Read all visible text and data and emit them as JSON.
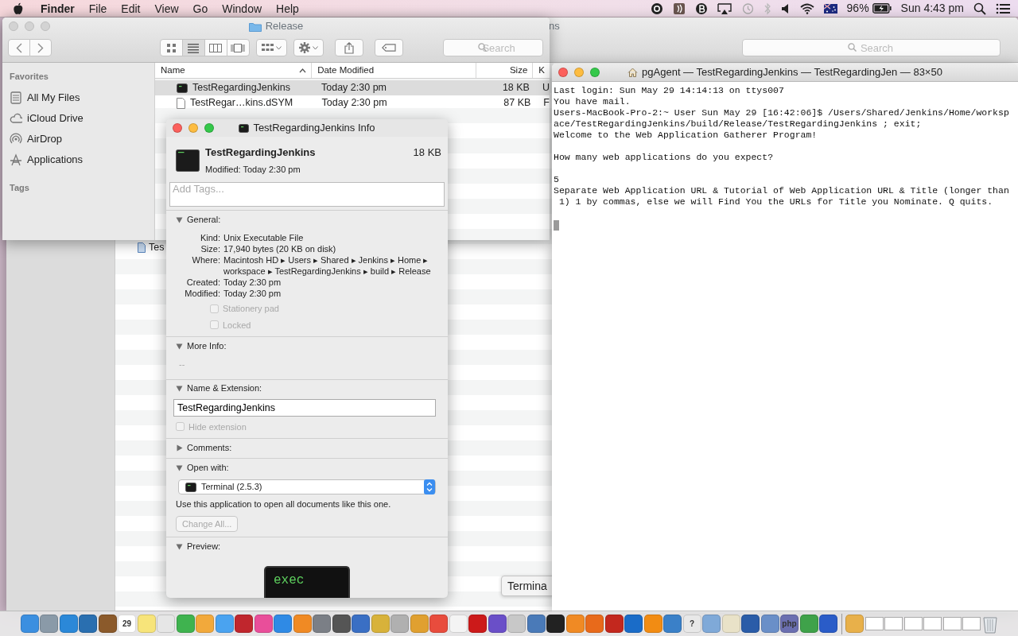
{
  "menu_bar": {
    "app": "Finder",
    "menus": [
      "File",
      "Edit",
      "View",
      "Go",
      "Window",
      "Help"
    ],
    "battery_percent": "96%",
    "clock": "Sun 4:43 pm"
  },
  "background_window": {
    "title": "ns",
    "search_placeholder": "Search",
    "file_name": "Tes"
  },
  "finder": {
    "active": false,
    "title": "Release",
    "search_placeholder": "Search",
    "view_modes": [
      {
        "kind": "icons",
        "selected": false
      },
      {
        "kind": "list",
        "selected": true
      },
      {
        "kind": "columns",
        "selected": false
      },
      {
        "kind": "coverflow",
        "selected": false
      }
    ],
    "sidebar": [
      {
        "heading": "Favorites",
        "items": [
          {
            "label": "All My Files",
            "kind": "files"
          },
          {
            "label": "iCloud Drive",
            "kind": "cloud"
          },
          {
            "label": "AirDrop",
            "kind": "airdrop"
          },
          {
            "label": "Applications",
            "kind": "apps"
          }
        ]
      },
      {
        "heading": "Tags"
      }
    ],
    "columns": [
      "Name",
      "Date Modified",
      "Size",
      "K"
    ],
    "rows": [
      {
        "kind": "executable",
        "name": "TestRegardingJenkins",
        "date": "Today 2:30 pm",
        "size": "18 KB",
        "column_4": "U",
        "selected": true
      },
      {
        "kind": "document",
        "name": "TestRegar…kins.dSYM",
        "date": "Today 2:30 pm",
        "size": "87 KB",
        "column_4": "F",
        "selected": false
      }
    ]
  },
  "info": {
    "active": true,
    "title": "TestRegardingJenkins Info",
    "name": "TestRegardingJenkins",
    "modified": "Modified: Today 2:30 pm",
    "size": "18 KB",
    "tags_placeholder": "Add Tags...",
    "sections": [
      {
        "kind": "general",
        "title": "General:",
        "expanded": true,
        "fields": [
          {
            "label": "Kind:",
            "value": "Unix Executable File"
          },
          {
            "label": "Size:",
            "value": "17,940 bytes (20 KB on disk)"
          },
          {
            "label": "Where:",
            "value": "Macintosh HD ▸ Users ▸ Shared ▸ Jenkins ▸ Home ▸ workspace ▸ TestRegardingJenkins ▸ build ▸ Release"
          },
          {
            "label": "Created:",
            "value": "Today 2:30 pm"
          },
          {
            "label": "Modified:",
            "value": "Today 2:30 pm"
          }
        ],
        "checkboxes": [
          {
            "label": "Stationery pad",
            "checked": false,
            "disabled": true
          },
          {
            "label": "Locked",
            "checked": false,
            "disabled": true
          }
        ]
      },
      {
        "kind": "more_info",
        "title": "More Info:",
        "expanded": true,
        "value": "--"
      },
      {
        "kind": "name_extension",
        "title": "Name & Extension:",
        "expanded": true,
        "value": "TestRegardingJenkins",
        "checkboxes": [
          {
            "label": "Hide extension",
            "checked": false,
            "disabled": true
          }
        ]
      },
      {
        "kind": "comments",
        "title": "Comments:",
        "expanded": false
      },
      {
        "kind": "open_with",
        "title": "Open with:",
        "expanded": true,
        "app": "Terminal (2.5.3)",
        "hint": "Use this application to open all documents like this one.",
        "button": {
          "label": "Change All...",
          "disabled": true
        }
      },
      {
        "kind": "preview",
        "title": "Preview:",
        "expanded": true,
        "text": "exec"
      }
    ]
  },
  "terminal": {
    "active": true,
    "title": "pgAgent — TestRegardingJenkins — TestRegardingJen — 83×50",
    "paragraphs": [
      [
        "Last login: Sun May 29 14:14:13 on ttys007",
        "You have mail.",
        "Users-MacBook-Pro-2:~ User Sun May 29 [16:42:06]$ /Users/Shared/Jenkins/Home/worksp",
        "ace/TestRegardingJenkins/build/Release/TestRegardingJenkins ; exit;",
        "Welcome to the Web Application Gatherer Program!"
      ],
      [
        "How many web applications do you expect?"
      ],
      [
        "5",
        "Separate Web Application URL & Tutorial of Web Application URL & Title (longer than",
        " 1) 1 by commas, else we will Find You the URLs for Title you Nominate. Q quits."
      ]
    ],
    "cursor": true
  },
  "tooltip": {
    "text": "Termina"
  },
  "dock": [
    {
      "kind": "app",
      "color": "#3b8fe0"
    },
    {
      "kind": "app",
      "color": "#8a9aa8"
    },
    {
      "kind": "app",
      "color": "#2b88d8"
    },
    {
      "kind": "app",
      "color": "#2a6fb0"
    },
    {
      "kind": "app",
      "color": "#8b5a2b"
    },
    {
      "kind": "labeled",
      "color": "#ffffff",
      "label": "29"
    },
    {
      "kind": "app",
      "color": "#f7e47a"
    },
    {
      "kind": "app",
      "color": "#e6e6e6"
    },
    {
      "kind": "app",
      "color": "#3fb34f"
    },
    {
      "kind": "app",
      "color": "#f2a93b"
    },
    {
      "kind": "app",
      "color": "#4aa3f0"
    },
    {
      "kind": "app",
      "color": "#c0262d"
    },
    {
      "kind": "app",
      "color": "#e94e9a"
    },
    {
      "kind": "app",
      "color": "#2f8ae5"
    },
    {
      "kind": "app",
      "color": "#f08a24"
    },
    {
      "kind": "app",
      "color": "#7b7f86"
    },
    {
      "kind": "app",
      "color": "#555555"
    },
    {
      "kind": "app",
      "color": "#3a6fc4"
    },
    {
      "kind": "app",
      "color": "#d8b23a"
    },
    {
      "kind": "app",
      "color": "#b0b0b0"
    },
    {
      "kind": "app",
      "color": "#e0a030"
    },
    {
      "kind": "app",
      "color": "#e84c3d"
    },
    {
      "kind": "app",
      "color": "#f4f4f4"
    },
    {
      "kind": "app",
      "color": "#cc1a1a"
    },
    {
      "kind": "app",
      "color": "#6a4fc8"
    },
    {
      "kind": "app",
      "color": "#c8c8c8"
    },
    {
      "kind": "app",
      "color": "#4a7ab8"
    },
    {
      "kind": "app",
      "color": "#222222"
    },
    {
      "kind": "app",
      "color": "#f08a24"
    },
    {
      "kind": "app",
      "color": "#e86a1b"
    },
    {
      "kind": "app",
      "color": "#c3281e"
    },
    {
      "kind": "app",
      "color": "#1a6cc8"
    },
    {
      "kind": "app",
      "color": "#f28c13"
    },
    {
      "kind": "app",
      "color": "#3a80c8"
    },
    {
      "kind": "labeled",
      "color": "#e8e8e8",
      "label": "?"
    },
    {
      "kind": "app",
      "color": "#7fa9d8"
    },
    {
      "kind": "app",
      "color": "#e9e2c8"
    },
    {
      "kind": "app",
      "color": "#2a5ca8"
    },
    {
      "kind": "app",
      "color": "#6a8fc8"
    },
    {
      "kind": "labeled",
      "color": "#6b6fb0",
      "label": "php"
    },
    {
      "kind": "app",
      "color": "#3fa24a"
    },
    {
      "kind": "app",
      "color": "#2a5cc8"
    },
    {
      "kind": "separator"
    },
    {
      "kind": "app",
      "color": "#e8b04a"
    },
    {
      "kind": "window"
    },
    {
      "kind": "window"
    },
    {
      "kind": "window"
    },
    {
      "kind": "window"
    },
    {
      "kind": "window"
    },
    {
      "kind": "window"
    },
    {
      "kind": "trash"
    }
  ]
}
